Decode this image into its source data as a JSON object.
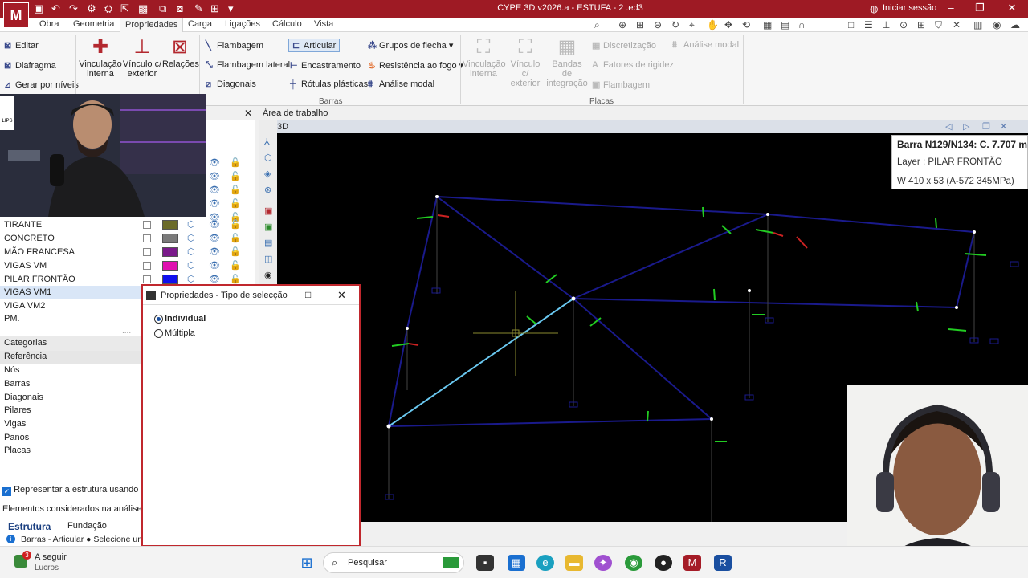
{
  "title_bar": {
    "logo": "M",
    "window_title": "CYPE 3D v2026.a - ESTUFA - 2 .ed3",
    "session_label": "Iniciar sessão"
  },
  "menu": {
    "tabs": [
      "Obra",
      "Geometria",
      "Propriedades",
      "Carga",
      "Ligações",
      "Cálculo",
      "Vista"
    ],
    "active": "Propriedades"
  },
  "ribbon": {
    "left": {
      "editar": "Editar",
      "diafragma": "Diafragma",
      "gerar": "Gerar por níveis"
    },
    "vinc_interna": "Vinculação interna",
    "vinc_exterior": "Vínculo c/ exterior",
    "relacoes": "Relações",
    "barras": {
      "flambagem": "Flambagem",
      "flambagem_lateral": "Flambagem lateral",
      "diagonais": "Diagonais",
      "articular": "Articular",
      "encastramento": "Encastramento",
      "rotulas": "Rótulas plásticas",
      "grupos_flecha": "Grupos de flecha",
      "resistencia_fogo": "Resistência ao fogo",
      "analise_modal": "Análise modal",
      "group_label": "Barras"
    },
    "placas": {
      "vinc_interna": "Vinculação interna",
      "vinc_exterior": "Vínculo c/ exterior",
      "bandas": "Bandas de integração",
      "discretizacao": "Discretização",
      "fatores": "Fatores de rigidez",
      "flambagem": "Flambagem",
      "analise_modal": "Análise modal",
      "group_label": "Placas"
    }
  },
  "layers": [
    {
      "name": "TIRANTE",
      "color": "#6b6b2a"
    },
    {
      "name": "CONCRETO",
      "color": "#7a7a7a"
    },
    {
      "name": "MÃO FRANCESA",
      "color": "#7a1a8a"
    },
    {
      "name": "VIGAS VM",
      "color": "#e010b0"
    },
    {
      "name": "PILAR FRONTÃO",
      "color": "#1010ee"
    },
    {
      "name": "VIGAS VM1",
      "color": "#ffffff"
    },
    {
      "name": "VIGA VM2",
      "color": ""
    },
    {
      "name": "PM.",
      "color": ""
    }
  ],
  "categories": {
    "header": "Categorias",
    "items": [
      "Referência",
      "Nós",
      "Barras",
      "Diagonais",
      "Pilares",
      "Vigas",
      "Panos",
      "Placas"
    ]
  },
  "options": {
    "representar": "Representar a estrutura usando as co",
    "elementos": "Elementos considerados na análise"
  },
  "bottom_tabs": {
    "estrutura": "Estrutura",
    "fundacao": "Fundação"
  },
  "status": "Barras - Articular  ●  Selecione um",
  "workspace": {
    "title": "Área de trabalho",
    "view_label": "3D"
  },
  "info_box": {
    "line1": "Barra N129/N134: C. 7.707 m",
    "line2": "Layer : PILAR FRONTÃO",
    "line3": "W 410 x 53 (A-572 345MPa)"
  },
  "dialog": {
    "title": "Propriedades - Tipo de selecção",
    "option1": "Individual",
    "option2": "Múltipla",
    "selected": "Individual"
  },
  "taskbar": {
    "notif_count": "3",
    "notif_title": "A seguir",
    "notif_sub": "Lucros",
    "search": "Pesquisar"
  },
  "webcam_badge": "LIPS"
}
